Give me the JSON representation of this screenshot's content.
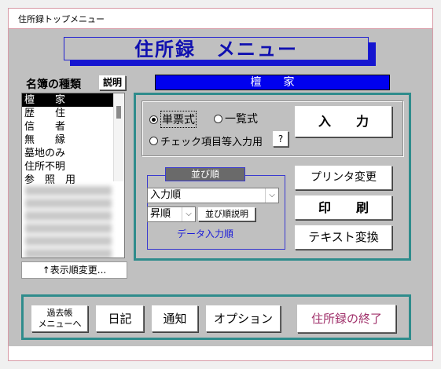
{
  "window": {
    "title": "住所録トップメニュー"
  },
  "banner": {
    "title": "住所録　メニュー"
  },
  "left": {
    "header": "名簿の種類",
    "explain_button": "説明",
    "items": [
      "檀　　家",
      "歴　　住",
      "信　　者",
      "無　　縁",
      "墓地のみ",
      "住所不明",
      "参　照　用"
    ],
    "selected_index": 0,
    "reorder_button": "↑表示順変更..."
  },
  "selected_bar": {
    "label": "檀　　家"
  },
  "print_section": {
    "radio_single": "単票式",
    "radio_list": "一覧式",
    "radio_check": "チェック項目等入力用",
    "help_button": "?",
    "selected_radio": "single",
    "input_button": "入　　力"
  },
  "sort_section": {
    "title": "並び順",
    "order_value": "入力順",
    "direction_value": "昇順",
    "sort_help_button": "並び順説明",
    "data_order_label": "データ入力順"
  },
  "actions": {
    "printer_change": "プリンタ変更",
    "print": "印　　刷",
    "text_convert": "テキスト変換"
  },
  "bottom": {
    "past_book": "過去帳\nメニューへ",
    "diary": "日記",
    "notice": "通知",
    "options": "オプション",
    "exit": "住所録の終了",
    "exit_color": "#a0306a"
  },
  "colors": {
    "accent_blue": "#0000ee",
    "teal_border": "#2f8c8c",
    "banner_text": "#1010b0"
  }
}
